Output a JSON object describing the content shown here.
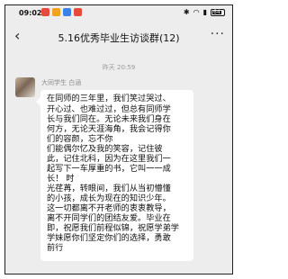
{
  "status_bar": {
    "time": "09:02",
    "battery": "64",
    "app_icon_colors": [
      "#e64a3c",
      "#f1a31b",
      "#3b82e6",
      "#e64a3c"
    ]
  },
  "header": {
    "back_icon": "chevron-left-icon",
    "title": "5.16优秀毕业生访谈群(12)",
    "more_icon": "more-dots-icon"
  },
  "chat": {
    "timestamp": "昨天 20:59",
    "message": {
      "sender": "大同学生 白涵",
      "lines": [
        "在同师的三年里，我们笑过哭过、",
        "开心过、也难过过，但总有同师学",
        "长与我们同在。无论未来我们身在",
        "何方，无论天涯海角，我会记得你",
        "们的容颜，忘不你",
        "们能偶尔忆及我的笑容，记住彼",
        "此，记住北科，因为在这里我们一",
        "起写下一车厚重的书，它叫一一成",
        "长！                              时",
        "光荏苒，转眼间，我们从当初懵懂",
        "的小孩，成长为现在的知识少年。",
        "这一切都离不开老师的衷衷教导，",
        "离不开同学们的团结友爱。毕业在",
        "即，祝愿我们前程似锦，祝愿学弟学",
        "学妹愿你们坚定你们的选择，勇敢",
        "前行"
      ]
    }
  }
}
